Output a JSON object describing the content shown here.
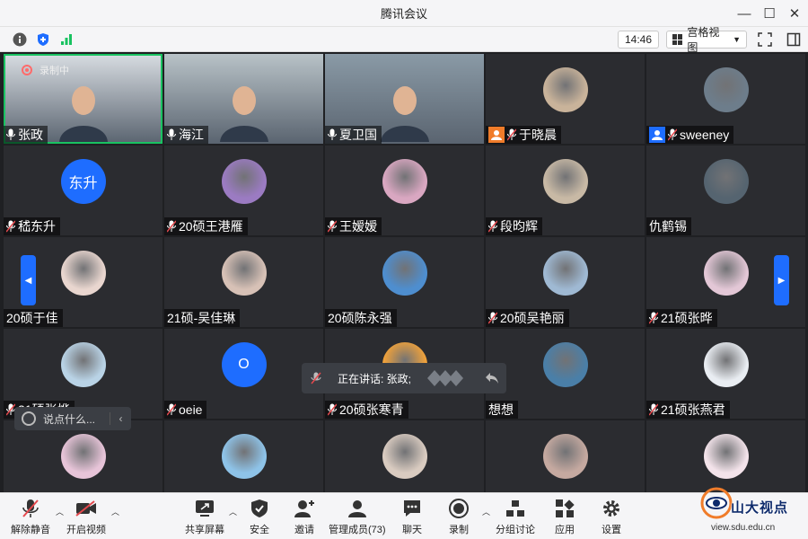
{
  "window": {
    "title": "腾讯会议"
  },
  "toolbar": {
    "time": "14:46",
    "view_label": "宫格视图"
  },
  "recording_indicator": "录制中",
  "participants": [
    {
      "name": "张政",
      "type": "video",
      "mic": "on",
      "active": true,
      "bg": "#d8dde2"
    },
    {
      "name": "海江",
      "type": "video",
      "mic": "on",
      "bg": "#b8c2c7"
    },
    {
      "name": "夏卫国",
      "type": "video",
      "mic": "on",
      "bg": "#8a9aa6"
    },
    {
      "name": "于晓晨",
      "type": "avatar",
      "mic": "muted",
      "badge": "orange",
      "color": "#c9b39a"
    },
    {
      "name": "sweeney",
      "type": "avatar",
      "mic": "muted",
      "badge": "blue",
      "color": "#6d7d8b"
    },
    {
      "name": "嵇东升",
      "type": "text-avatar",
      "initials": "东升",
      "mic": "muted"
    },
    {
      "name": "20硕王港雁",
      "type": "avatar",
      "mic": "muted",
      "color": "#9b7bc2"
    },
    {
      "name": "王嫒嫒",
      "type": "avatar",
      "mic": "muted",
      "color": "#d9a7c1"
    },
    {
      "name": "段昀辉",
      "type": "avatar",
      "mic": "muted",
      "color": "#c8b9a5"
    },
    {
      "name": "仇鹤锡",
      "type": "avatar",
      "mic": "none",
      "color": "#556470"
    },
    {
      "name": "20硕于佳",
      "type": "avatar",
      "mic": "none",
      "color": "#e9d6cf"
    },
    {
      "name": "21硕-吴佳琳",
      "type": "avatar",
      "mic": "none",
      "color": "#d7c1b6"
    },
    {
      "name": "20硕陈永强",
      "type": "avatar",
      "mic": "none",
      "color": "#4e8ecf"
    },
    {
      "name": "20硕吴艳丽",
      "type": "avatar",
      "mic": "muted",
      "color": "#9fb9d3"
    },
    {
      "name": "21硕张晔",
      "type": "avatar",
      "mic": "muted",
      "color": "#e3c7d6"
    },
    {
      "name": "21硕张烨",
      "type": "avatar",
      "mic": "muted",
      "color": "#b9d3e6"
    },
    {
      "name": "oeie",
      "type": "text-avatar",
      "initials": "O",
      "mic": "muted"
    },
    {
      "name": "20硕张寒青",
      "type": "avatar",
      "mic": "muted",
      "color": "#f1a23a"
    },
    {
      "name": "想想",
      "type": "avatar",
      "mic": "none",
      "color": "#4a7fa8"
    },
    {
      "name": "21硕张燕君",
      "type": "avatar",
      "mic": "muted",
      "color": "#e9edf2"
    },
    {
      "name": "",
      "type": "avatar",
      "mic": "none",
      "color": "#e7c4d8"
    },
    {
      "name": "",
      "type": "avatar",
      "mic": "none",
      "color": "#8ec3e8"
    },
    {
      "name": "",
      "type": "avatar",
      "mic": "none",
      "color": "#d9cbc0"
    },
    {
      "name": "",
      "type": "avatar",
      "mic": "none",
      "color": "#c5a9a0"
    },
    {
      "name": "",
      "type": "avatar",
      "mic": "none",
      "color": "#f3e3ea"
    }
  ],
  "speaking": {
    "label": "正在讲话: 张政;"
  },
  "chat": {
    "placeholder": "说点什么..."
  },
  "bottom": {
    "unmute": "解除静音",
    "video": "开启视频",
    "share": "共享屏幕",
    "security": "安全",
    "invite": "邀请",
    "members": "管理成员(73)",
    "chat": "聊天",
    "record": "录制",
    "breakout": "分组讨论",
    "apps": "应用",
    "settings": "设置"
  },
  "watermark": {
    "brand": "山大视点",
    "url": "view.sdu.edu.cn"
  },
  "colors": {
    "accent": "#1e6dff",
    "speaking_outline": "#19c261",
    "muted_red": "#e5484d"
  }
}
